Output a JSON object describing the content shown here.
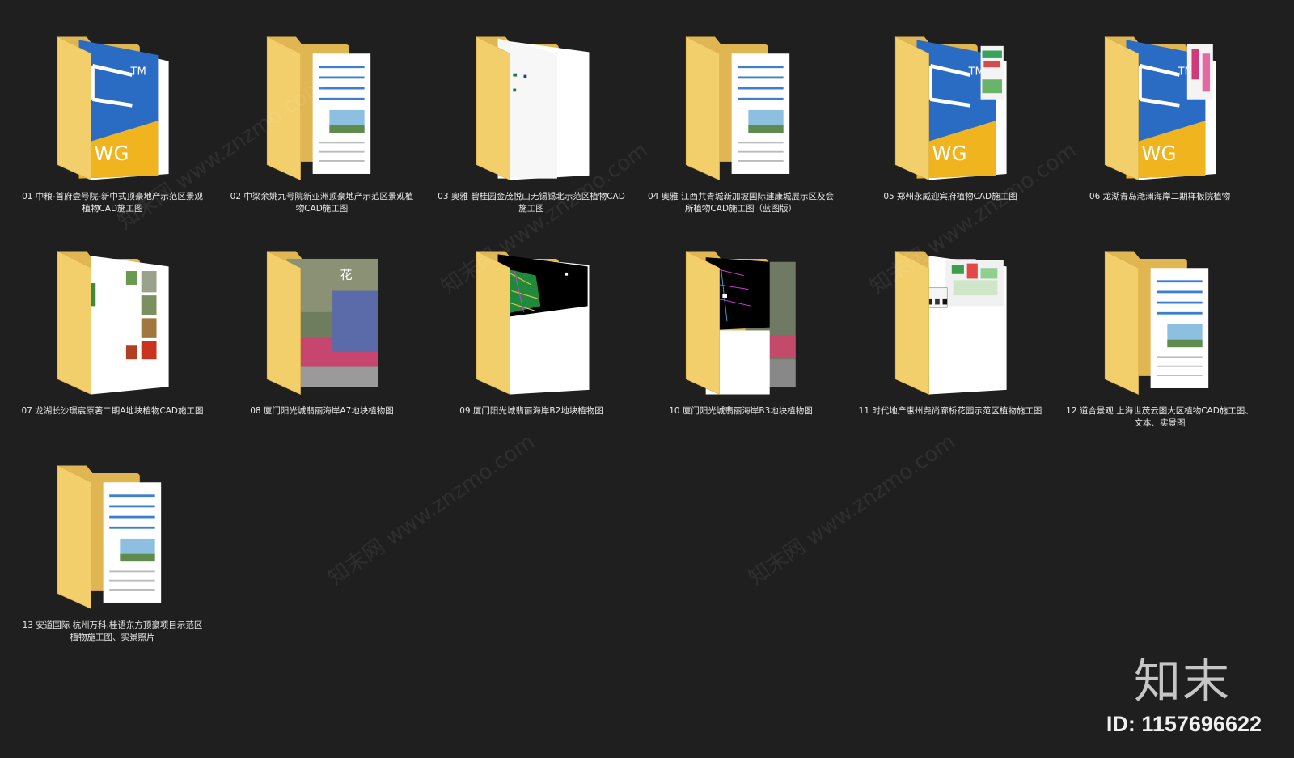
{
  "folders": [
    {
      "label": "01  中粮-首府壹号院-新中式顶豪地产示范区景观植物CAD施工图",
      "preview": "dwg"
    },
    {
      "label": "02  中梁余姚九号院新亚洲顶豪地产示范区景观植物CAD施工图",
      "preview": "doc"
    },
    {
      "label": "03  奥雅 碧桂园金茂悦山无锡锡北示范区植物CAD施工图",
      "preview": "white"
    },
    {
      "label": "04  奥雅 江西共青城新加坡国际建康城展示区及会所植物CAD施工图（蓝图版）",
      "preview": "doc"
    },
    {
      "label": "05  郑州永威迎宾府植物CAD施工图",
      "preview": "dwg-plan"
    },
    {
      "label": "06  龙湖青岛滟澜海岸二期样板院植物",
      "preview": "dwg-pink"
    },
    {
      "label": "07  龙湖长沙璟宸原著二期A地块植物CAD施工图",
      "preview": "photos"
    },
    {
      "label": "08  厦门阳光城翡丽海岸A7地块植物图",
      "preview": "garden"
    },
    {
      "label": "09  厦门阳光城翡丽海岸B2地块植物图",
      "preview": "cad-black"
    },
    {
      "label": "10  厦门阳光城翡丽海岸B3地块植物图",
      "preview": "cad-garden"
    },
    {
      "label": "11  时代地产惠州尧尚廊桥花园示范区植物施工图",
      "preview": "plan"
    },
    {
      "label": "12  道合景观 上海世茂云图大区植物CAD施工图、文本、实景图",
      "preview": "doc"
    },
    {
      "label": "13  安道国际 杭州万科.桂语东方顶豪项目示范区植物施工图、实景照片",
      "preview": "doc"
    }
  ],
  "watermark": {
    "brand": "知末",
    "id": "ID: 1157696622",
    "diagonal": "知末网 www.znzmo.com"
  },
  "colors": {
    "background": "#1f1f1f",
    "folder": "#f3cf6b",
    "folder_dark": "#e0b653",
    "dwg_blue": "#2a6bc4",
    "dwg_yellow": "#f0b41e"
  }
}
